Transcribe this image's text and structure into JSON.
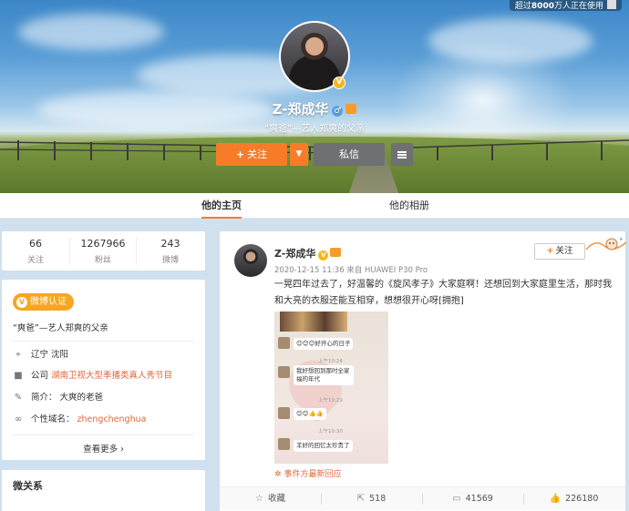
{
  "banner": {
    "prefix": "超过",
    "count": "8000",
    "suffix": "万人正在使用"
  },
  "profile": {
    "name": "Z-郑成华",
    "gender_icon": "♂",
    "subtitle": "“爽爸”—艺人郑爽的父亲",
    "follow_label": "关注",
    "message_label": "私信"
  },
  "tabs": [
    {
      "label": "他的主页",
      "active": true
    },
    {
      "label": "他的相册",
      "active": false
    }
  ],
  "stats": [
    {
      "value": "66",
      "label": "关注"
    },
    {
      "value": "1267966",
      "label": "粉丝"
    },
    {
      "value": "243",
      "label": "微博"
    }
  ],
  "info": {
    "verify_label": "微博认证",
    "intro": "“爽爸”—艺人郑爽的父亲",
    "location": "辽宁 沈阳",
    "company_prefix": "公司",
    "company": "湖南卫视大型季播类真人秀节目",
    "bio_prefix": "简介：",
    "bio": "大爽的老爸",
    "domain_prefix": "个性域名：",
    "domain": "zhengchenghua",
    "more_label": "查看更多"
  },
  "relations": {
    "title": "微关系"
  },
  "post": {
    "author": "Z-郑成华",
    "meta": "2020-12-15 11:36 来自 HUAWEI P30 Pro",
    "text": "一晃四年过去了，好温馨的《旋风孝子》大家庭啊！还想回到大家庭里生活，那时我和大亮的衣服还能互相穿，想想很开心呀[拥抱]",
    "follow_label": "关注",
    "event_label": "事件方最新回应",
    "chat": {
      "msg1": "好开心的日子",
      "msg2": "我好想回到那时全家福的年代",
      "msg3": "羊好的回忆太珍贵了",
      "time1": "上午10:24",
      "time2": "上午10:29",
      "time3": "上午10:30"
    },
    "actions": [
      {
        "icon": "star-icon",
        "label": "收藏"
      },
      {
        "icon": "share-icon",
        "label": "518"
      },
      {
        "icon": "comment-icon",
        "label": "41569"
      },
      {
        "icon": "like-icon",
        "label": "226180"
      }
    ]
  },
  "colors": {
    "accent": "#f77c27",
    "button_dark": "#6e7072",
    "verify": "#f5a623",
    "link": "#e0683c"
  }
}
